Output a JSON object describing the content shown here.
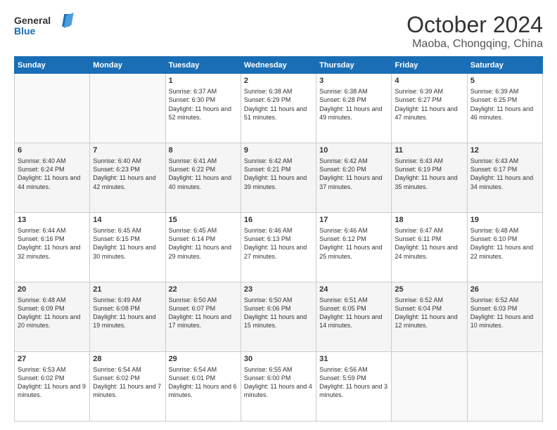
{
  "logo": {
    "line1": "General",
    "line2": "Blue"
  },
  "title": "October 2024",
  "subtitle": "Maoba, Chongqing, China",
  "days_of_week": [
    "Sunday",
    "Monday",
    "Tuesday",
    "Wednesday",
    "Thursday",
    "Friday",
    "Saturday"
  ],
  "weeks": [
    [
      {
        "day": "",
        "content": ""
      },
      {
        "day": "",
        "content": ""
      },
      {
        "day": "1",
        "content": "Sunrise: 6:37 AM\nSunset: 6:30 PM\nDaylight: 11 hours and 52 minutes."
      },
      {
        "day": "2",
        "content": "Sunrise: 6:38 AM\nSunset: 6:29 PM\nDaylight: 11 hours and 51 minutes."
      },
      {
        "day": "3",
        "content": "Sunrise: 6:38 AM\nSunset: 6:28 PM\nDaylight: 11 hours and 49 minutes."
      },
      {
        "day": "4",
        "content": "Sunrise: 6:39 AM\nSunset: 6:27 PM\nDaylight: 11 hours and 47 minutes."
      },
      {
        "day": "5",
        "content": "Sunrise: 6:39 AM\nSunset: 6:25 PM\nDaylight: 11 hours and 46 minutes."
      }
    ],
    [
      {
        "day": "6",
        "content": "Sunrise: 6:40 AM\nSunset: 6:24 PM\nDaylight: 11 hours and 44 minutes."
      },
      {
        "day": "7",
        "content": "Sunrise: 6:40 AM\nSunset: 6:23 PM\nDaylight: 11 hours and 42 minutes."
      },
      {
        "day": "8",
        "content": "Sunrise: 6:41 AM\nSunset: 6:22 PM\nDaylight: 11 hours and 40 minutes."
      },
      {
        "day": "9",
        "content": "Sunrise: 6:42 AM\nSunset: 6:21 PM\nDaylight: 11 hours and 39 minutes."
      },
      {
        "day": "10",
        "content": "Sunrise: 6:42 AM\nSunset: 6:20 PM\nDaylight: 11 hours and 37 minutes."
      },
      {
        "day": "11",
        "content": "Sunrise: 6:43 AM\nSunset: 6:19 PM\nDaylight: 11 hours and 35 minutes."
      },
      {
        "day": "12",
        "content": "Sunrise: 6:43 AM\nSunset: 6:17 PM\nDaylight: 11 hours and 34 minutes."
      }
    ],
    [
      {
        "day": "13",
        "content": "Sunrise: 6:44 AM\nSunset: 6:16 PM\nDaylight: 11 hours and 32 minutes."
      },
      {
        "day": "14",
        "content": "Sunrise: 6:45 AM\nSunset: 6:15 PM\nDaylight: 11 hours and 30 minutes."
      },
      {
        "day": "15",
        "content": "Sunrise: 6:45 AM\nSunset: 6:14 PM\nDaylight: 11 hours and 29 minutes."
      },
      {
        "day": "16",
        "content": "Sunrise: 6:46 AM\nSunset: 6:13 PM\nDaylight: 11 hours and 27 minutes."
      },
      {
        "day": "17",
        "content": "Sunrise: 6:46 AM\nSunset: 6:12 PM\nDaylight: 11 hours and 25 minutes."
      },
      {
        "day": "18",
        "content": "Sunrise: 6:47 AM\nSunset: 6:11 PM\nDaylight: 11 hours and 24 minutes."
      },
      {
        "day": "19",
        "content": "Sunrise: 6:48 AM\nSunset: 6:10 PM\nDaylight: 11 hours and 22 minutes."
      }
    ],
    [
      {
        "day": "20",
        "content": "Sunrise: 6:48 AM\nSunset: 6:09 PM\nDaylight: 11 hours and 20 minutes."
      },
      {
        "day": "21",
        "content": "Sunrise: 6:49 AM\nSunset: 6:08 PM\nDaylight: 11 hours and 19 minutes."
      },
      {
        "day": "22",
        "content": "Sunrise: 6:50 AM\nSunset: 6:07 PM\nDaylight: 11 hours and 17 minutes."
      },
      {
        "day": "23",
        "content": "Sunrise: 6:50 AM\nSunset: 6:06 PM\nDaylight: 11 hours and 15 minutes."
      },
      {
        "day": "24",
        "content": "Sunrise: 6:51 AM\nSunset: 6:05 PM\nDaylight: 11 hours and 14 minutes."
      },
      {
        "day": "25",
        "content": "Sunrise: 6:52 AM\nSunset: 6:04 PM\nDaylight: 11 hours and 12 minutes."
      },
      {
        "day": "26",
        "content": "Sunrise: 6:52 AM\nSunset: 6:03 PM\nDaylight: 11 hours and 10 minutes."
      }
    ],
    [
      {
        "day": "27",
        "content": "Sunrise: 6:53 AM\nSunset: 6:02 PM\nDaylight: 11 hours and 9 minutes."
      },
      {
        "day": "28",
        "content": "Sunrise: 6:54 AM\nSunset: 6:02 PM\nDaylight: 11 hours and 7 minutes."
      },
      {
        "day": "29",
        "content": "Sunrise: 6:54 AM\nSunset: 6:01 PM\nDaylight: 11 hours and 6 minutes."
      },
      {
        "day": "30",
        "content": "Sunrise: 6:55 AM\nSunset: 6:00 PM\nDaylight: 11 hours and 4 minutes."
      },
      {
        "day": "31",
        "content": "Sunrise: 6:56 AM\nSunset: 5:59 PM\nDaylight: 11 hours and 3 minutes."
      },
      {
        "day": "",
        "content": ""
      },
      {
        "day": "",
        "content": ""
      }
    ]
  ]
}
